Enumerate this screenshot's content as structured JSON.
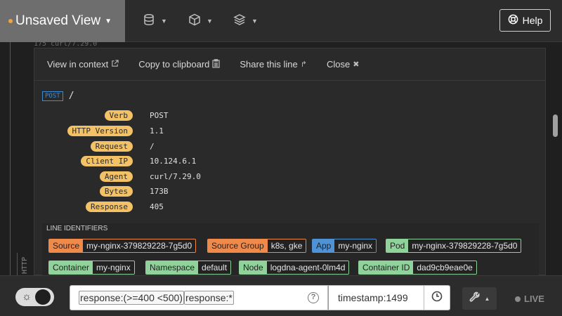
{
  "header": {
    "view_title": "Unsaved View",
    "icons": [
      "database-icon",
      "box-icon",
      "layers-icon"
    ],
    "help_label": "Help"
  },
  "faded_line": "175      curl/7.29.0",
  "panel": {
    "actions": {
      "view_in_context": "View in context",
      "copy_to_clipboard": "Copy to clipboard",
      "share_this_line": "Share this line",
      "close": "Close"
    },
    "method": "POST",
    "path": "/",
    "fields": [
      {
        "key": "Verb",
        "value": "POST"
      },
      {
        "key": "HTTP Version",
        "value": "1.1"
      },
      {
        "key": "Request",
        "value": "/"
      },
      {
        "key": "Client IP",
        "value": "10.124.6.1"
      },
      {
        "key": "Agent",
        "value": "curl/7.29.0"
      },
      {
        "key": "Bytes",
        "value": "173B"
      },
      {
        "key": "Response",
        "value": "405"
      }
    ],
    "line_identifiers_title": "LINE IDENTIFIERS",
    "identifiers": [
      {
        "key": "Source",
        "value": "my-nginx-379829228-7g5d0",
        "color": "orange"
      },
      {
        "key": "Source Group",
        "value": "k8s, gke",
        "color": "orange"
      },
      {
        "key": "App",
        "value": "my-nginx",
        "color": "blue"
      },
      {
        "key": "Pod",
        "value": "my-nginx-379829228-7g5d0",
        "color": "green"
      },
      {
        "key": "Container",
        "value": "my-nginx",
        "color": "green"
      },
      {
        "key": "Namespace",
        "value": "default",
        "color": "green"
      },
      {
        "key": "Node",
        "value": "logdna-agent-0lm4d",
        "color": "green"
      },
      {
        "key": "Container ID",
        "value": "dad9cb9eae0e",
        "color": "green"
      }
    ]
  },
  "side_label": "HTTP",
  "bottom": {
    "query_chips": [
      "response:(>=400 <500)",
      "response:*"
    ],
    "timestamp_query": "timestamp:1499",
    "live_label": "LIVE"
  },
  "colors": {
    "field_key_bg": "#f3c267",
    "orange": "#f08a4b",
    "blue": "#4f93d6",
    "green": "#8fd39a",
    "post_badge": "#3a8ed6"
  }
}
